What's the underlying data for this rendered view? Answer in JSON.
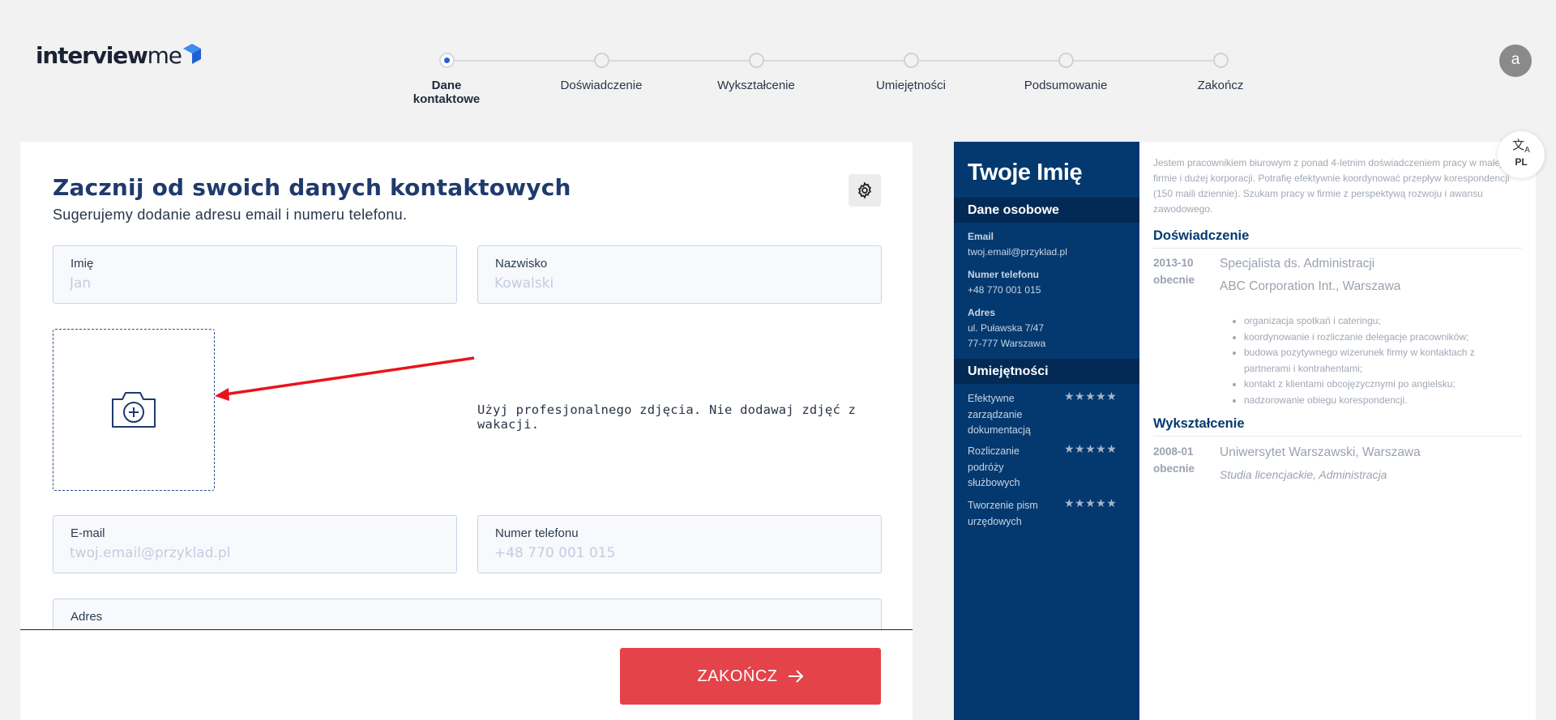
{
  "logo": {
    "bold": "interview",
    "light": "me"
  },
  "steps": [
    {
      "label": "Dane kontaktowe",
      "active": true
    },
    {
      "label": "Doświadczenie",
      "active": false
    },
    {
      "label": "Wykształcenie",
      "active": false
    },
    {
      "label": "Umiejętności",
      "active": false
    },
    {
      "label": "Podsumowanie",
      "active": false
    },
    {
      "label": "Zakończ",
      "active": false
    }
  ],
  "avatar_letter": "a",
  "form": {
    "title": "Zacznij od swoich danych kontaktowych",
    "subtitle": "Sugerujemy dodanie adresu email i numeru telefonu.",
    "first_name": {
      "label": "Imię",
      "placeholder": "Jan",
      "value": ""
    },
    "last_name": {
      "label": "Nazwisko",
      "placeholder": "Kowalski",
      "value": ""
    },
    "photo_hint": "Użyj profesjonalnego zdjęcia. Nie dodawaj zdjęć z wakacji.",
    "email": {
      "label": "E-mail",
      "placeholder": "twoj.email@przyklad.pl",
      "value": ""
    },
    "phone": {
      "label": "Numer telefonu",
      "placeholder": "+48 770 001 015",
      "value": ""
    },
    "address": {
      "label": "Adres"
    },
    "finish_label": "ZAKOŃCZ"
  },
  "language": {
    "code": "PL"
  },
  "resume": {
    "name": "Twoje Imię",
    "personal_heading": "Dane osobowe",
    "email_label": "Email",
    "email_value": "twoj.email@przyklad.pl",
    "phone_label": "Numer telefonu",
    "phone_value": "+48 770 001 015",
    "address_label": "Adres",
    "address_line1": "ul. Puławska 7/47",
    "address_line2": "77-777 Warszawa",
    "skills_heading": "Umiejętności",
    "skills": [
      {
        "name": "Efektywne zarządzanie dokumentacją",
        "stars": "★★★★★"
      },
      {
        "name": "Rozliczanie podróży służbowych",
        "stars": "★★★★★"
      },
      {
        "name": "Tworzenie pism urzędowych",
        "stars": "★★★★★"
      }
    ],
    "summary": "Jestem pracownikiem biurowym z ponad 4-letnim doświadczeniem pracy w małej firmie i dużej korporacji. Potrafię efektywnie koordynować przepływ korespondencji (150 maili dziennie). Szukam pracy w firmie z perspektywą rozwoju i awansu zawodowego.",
    "experience_heading": "Doświadczenie",
    "exp_date_start": "2013-10",
    "exp_date_end": "obecnie",
    "exp_role": "Specjalista ds. Administracji",
    "exp_company": "ABC Corporation Int., Warszawa",
    "exp_duties": [
      "organizacja spotkań i cateringu;",
      "koordynowanie i rozliczanie delegacje pracowników;",
      "budowa pozytywnego wizerunek firmy w kontaktach z partnerami i kontrahentami;",
      "kontakt z klientami obcojęzycznymi po angielsku;",
      "nadzorowanie obiegu korespondencji."
    ],
    "education_heading": "Wykształcenie",
    "edu_date_start": "2008-01",
    "edu_date_end": "obecnie",
    "edu_school": "Uniwersytet Warszawski, Warszawa",
    "edu_degree": "Studia licencjackie, Administracja"
  }
}
